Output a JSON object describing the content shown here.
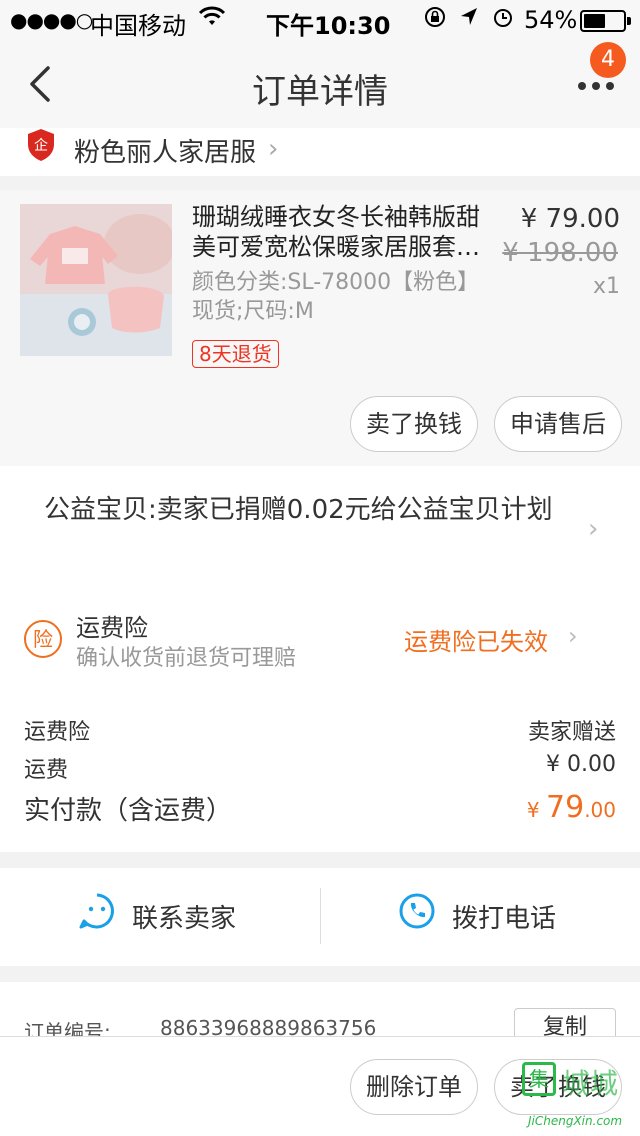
{
  "status_bar": {
    "signal": "●●●●○",
    "carrier": "中国移动",
    "time": "下午10:30",
    "battery": "54%",
    "battery_level": 0.54
  },
  "nav": {
    "title": "订单详情",
    "badge_count": "4"
  },
  "shop": {
    "name": "粉色丽人家居服"
  },
  "product": {
    "name": "珊瑚绒睡衣女冬长袖韩版甜美可爱宽松保暖家居服套…",
    "price": "¥ 79.00",
    "original_price": "¥ 198.00",
    "quantity": "x1",
    "spec": "颜色分类:SL-78000【粉色】现货;尺码:M",
    "return_tag": "8天退货",
    "sell_button": "卖了换钱",
    "aftersale_button": "申请售后"
  },
  "charity": {
    "text": "公益宝贝:卖家已捐赠0.02元给公益宝贝计划"
  },
  "insurance": {
    "icon_text": "险",
    "title": "运费险",
    "subtitle": "确认收货前退货可理赔",
    "status": "运费险已失效",
    "status_color": "#f06e1f"
  },
  "summary": {
    "insurance_label": "运费险",
    "insurance_value": "卖家赠送",
    "shipping_label": "运费",
    "shipping_value": "¥ 0.00",
    "total_label": "实付款（含运费）",
    "total_currency": "¥ ",
    "total_int": "79",
    "total_dec": ".00"
  },
  "contact": {
    "seller_label": "联系卖家",
    "phone_label": "拨打电话",
    "accent_color": "#1aa0e8"
  },
  "order": {
    "number_label": "订单编号:",
    "number": "88633968889863756",
    "copy_button": "复制"
  },
  "bottom": {
    "delete_button": "删除订单",
    "sell_button": "卖了换钱"
  },
  "watermark": {
    "box_text": "集",
    "cn": "城城",
    "en": "JiChengXin.com"
  }
}
